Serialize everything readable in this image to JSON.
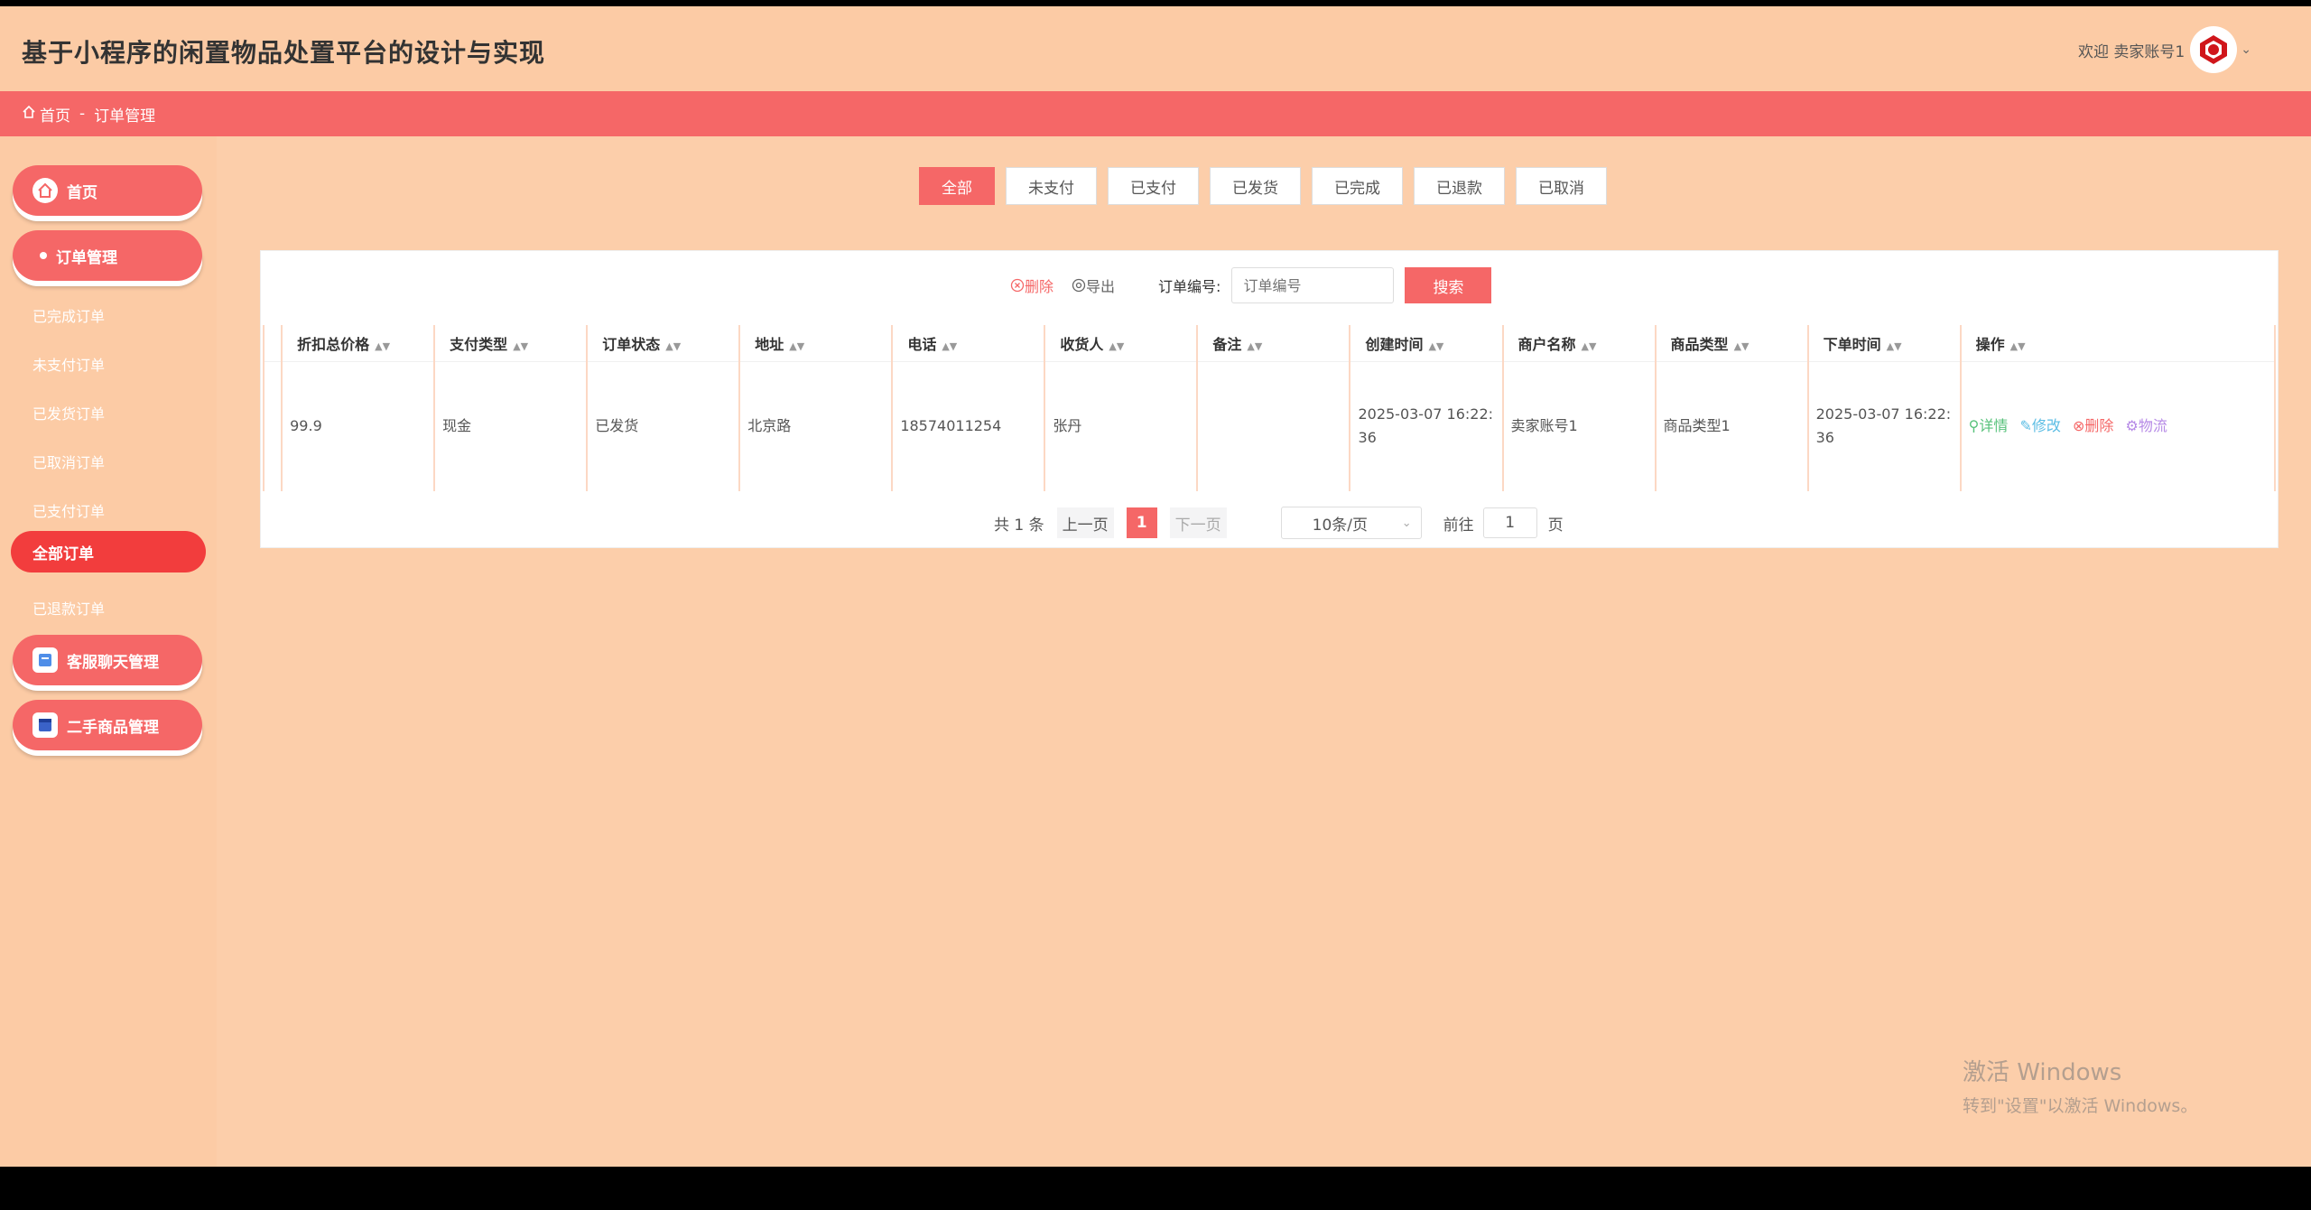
{
  "header": {
    "title": "基于小程序的闲置物品处置平台的设计与实现",
    "welcome": "欢迎 卖家账号1"
  },
  "breadcrumb": {
    "home": "首页",
    "separator": "-",
    "current": "订单管理"
  },
  "sidebar": {
    "home": "首页",
    "order_mgmt": "订单管理",
    "sub_items": [
      "已完成订单",
      "未支付订单",
      "已发货订单",
      "已取消订单",
      "已支付订单",
      "全部订单",
      "已退款订单"
    ],
    "chat_mgmt": "客服聊天管理",
    "goods_mgmt": "二手商品管理"
  },
  "tabs": [
    "全部",
    "未支付",
    "已支付",
    "已发货",
    "已完成",
    "已退款",
    "已取消"
  ],
  "toolbar": {
    "delete": "删除",
    "export": "导出",
    "order_no_label": "订单编号:",
    "order_no_placeholder": "订单编号",
    "search": "搜索"
  },
  "table": {
    "headers": [
      "折扣总价格",
      "支付类型",
      "订单状态",
      "地址",
      "电话",
      "收货人",
      "备注",
      "创建时间",
      "商户名称",
      "商品类型",
      "下单时间",
      "操作"
    ],
    "rows": [
      {
        "price": "99.9",
        "pay_type": "现金",
        "status": "已发货",
        "address": "北京路",
        "phone": "18574011254",
        "receiver": "张丹",
        "remark": "",
        "created": "2025-03-07 16:22:36",
        "merchant": "卖家账号1",
        "goods_type": "商品类型1",
        "order_time": "2025-03-07 16:22:36"
      }
    ],
    "ops": {
      "detail": "详情",
      "edit": "修改",
      "delete": "删除",
      "logistics": "物流"
    }
  },
  "pagination": {
    "total": "共 1 条",
    "prev": "上一页",
    "current": "1",
    "next": "下一页",
    "page_size": "10条/页",
    "goto": "前往",
    "goto_value": "1",
    "unit": "页"
  },
  "watermark": {
    "line1": "激活 Windows",
    "line2": "转到\"设置\"以激活 Windows。"
  },
  "colors": {
    "accent": "#f56767",
    "background": "#fcceaa",
    "active_item": "#f23d3d"
  }
}
